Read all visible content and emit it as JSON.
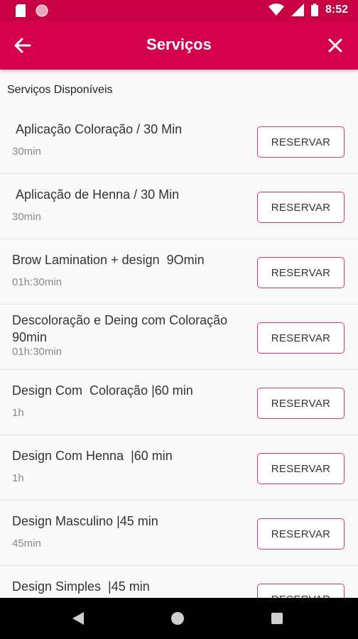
{
  "status_bar": {
    "time": "8:52",
    "icons": [
      "sd-card-icon",
      "app-notification-icon",
      "wifi-icon",
      "signal-icon",
      "battery-icon"
    ]
  },
  "app_bar": {
    "title": "Serviços",
    "back_icon": "arrow-left-icon",
    "close_icon": "close-icon"
  },
  "section_title": "Serviços Disponíveis",
  "services": [
    {
      "name": " Aplicação Coloração / 30 Min",
      "duration": "30min",
      "button": "RESERVAR"
    },
    {
      "name": " Aplicação de Henna / 30 Min",
      "duration": "30min",
      "button": "RESERVAR"
    },
    {
      "name": "Brow Lamination + design  9Omin",
      "duration": "01h:30min",
      "button": "RESERVAR"
    },
    {
      "name": "Descoloração e Deing com Coloração  90min",
      "duration": "01h:30min",
      "button": "RESERVAR"
    },
    {
      "name": "Design Com  Coloração |60 min",
      "duration": "1h",
      "button": "RESERVAR"
    },
    {
      "name": "Design Com Henna  |60 min",
      "duration": "1h",
      "button": "RESERVAR"
    },
    {
      "name": "Design Masculino |45 min",
      "duration": "45min",
      "button": "RESERVAR"
    },
    {
      "name": "Design Simples  |45 min",
      "duration": "",
      "button": "RESERVAR"
    }
  ],
  "nav_bar": {
    "icons": [
      "nav-back-icon",
      "nav-home-icon",
      "nav-recents-icon"
    ]
  },
  "colors": {
    "primary": "#d4004d",
    "status_bar": "#c80045",
    "button_border": "#d7386a",
    "background": "#fafafa"
  }
}
